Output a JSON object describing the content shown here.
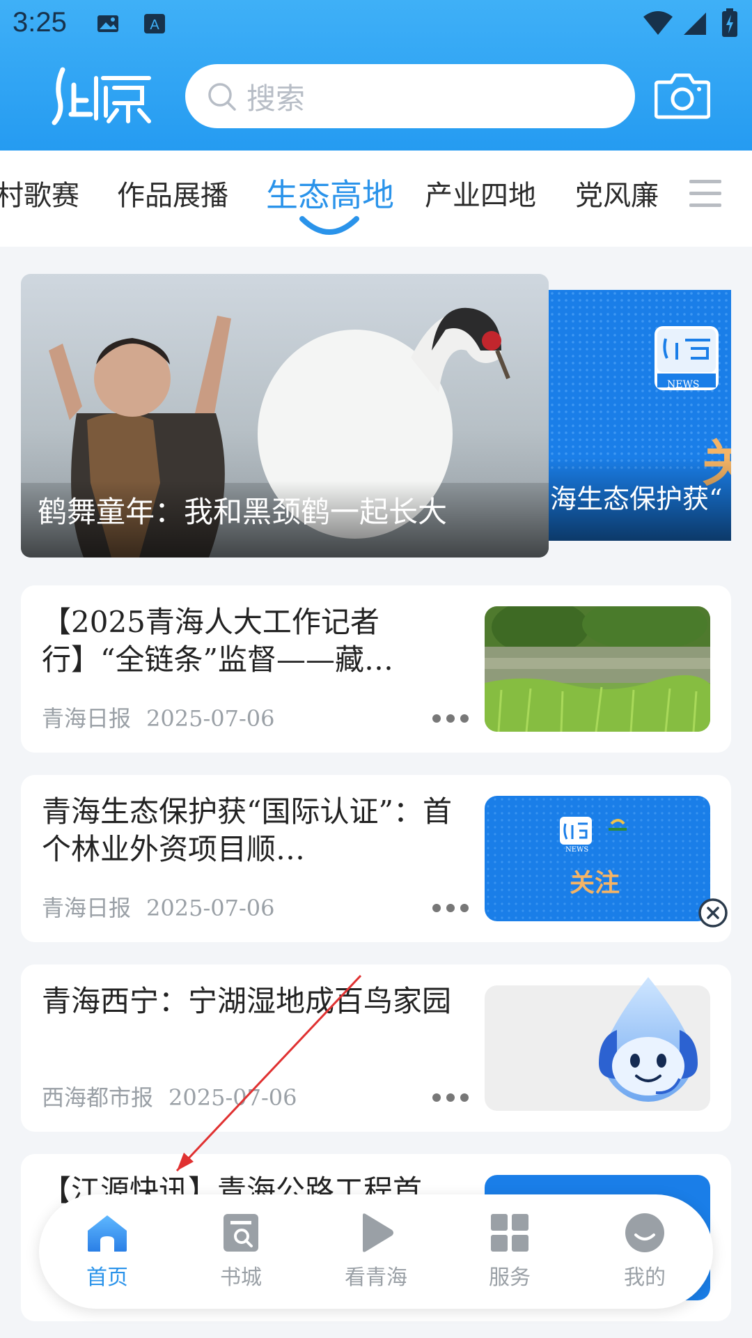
{
  "status_bar": {
    "time": "3:25"
  },
  "header": {
    "search_placeholder": "搜索"
  },
  "tabs": [
    {
      "label": "村歌赛"
    },
    {
      "label": "作品展播"
    },
    {
      "label": "生态高地",
      "active": true
    },
    {
      "label": "产业四地"
    },
    {
      "label": "党风廉"
    }
  ],
  "carousel": {
    "main_caption": "鹤舞童年：我和黑颈鹤一起长大",
    "peek_caption": "海生态保护获“",
    "peek_badge": "NEWS",
    "peek_big_text": "关"
  },
  "news": [
    {
      "title": "【2025青海人大工作记者行】“全链条”监督——藏…",
      "source": "青海日报",
      "date": "2025-07-06"
    },
    {
      "title": "青海生态保护获“国际认证”：首个林业外资项目顺…",
      "source": "青海日报",
      "date": "2025-07-06",
      "thumb_badge": "NEWS",
      "thumb_text": "关注"
    },
    {
      "title": "青海西宁：宁湖湿地成百鸟家园",
      "source": "西海都市报",
      "date": "2025-07-06"
    },
    {
      "title": "【江源快讯】青海公路工程首…",
      "source": "",
      "date": ""
    }
  ],
  "bottom_nav": [
    {
      "label": "首页",
      "icon": "home-icon",
      "active": true
    },
    {
      "label": "书城",
      "icon": "book-search-icon"
    },
    {
      "label": "看青海",
      "icon": "play-icon"
    },
    {
      "label": "服务",
      "icon": "grid-icon"
    },
    {
      "label": "我的",
      "icon": "smile-icon"
    }
  ],
  "colors": {
    "brand": "#259bf1",
    "accent": "#2a93ea",
    "annotation": "#e03131"
  }
}
